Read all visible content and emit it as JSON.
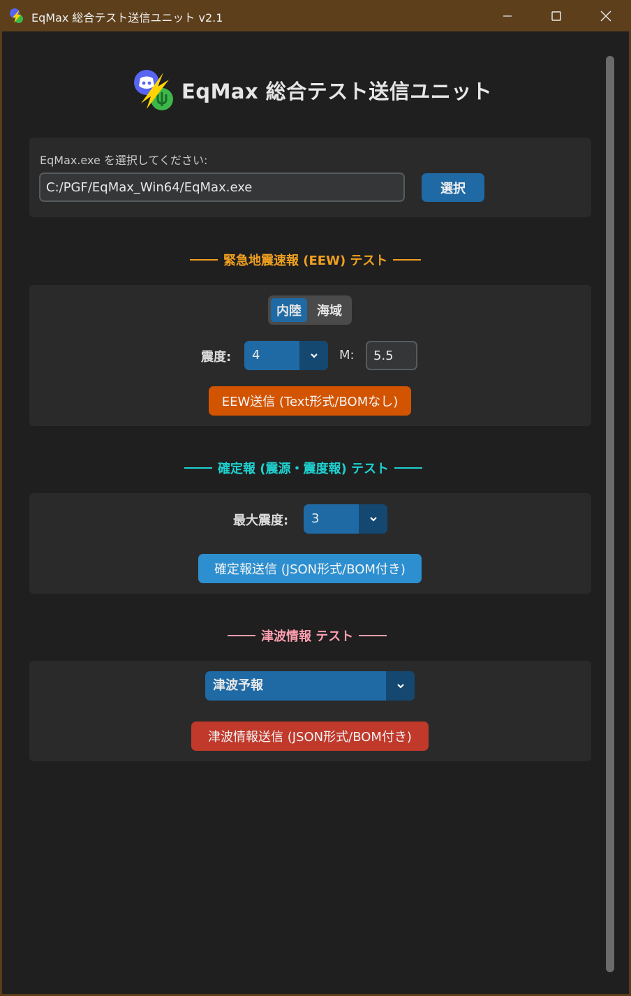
{
  "window": {
    "title": "EqMax 総合テスト送信ユニット v2.1"
  },
  "header": {
    "title": "EqMax 総合テスト送信ユニット"
  },
  "file_section": {
    "label": "EqMax.exe を選択してください:",
    "path_value": "C:/PGF/EqMax_Win64/EqMax.exe",
    "select_button": "選択"
  },
  "eew_section": {
    "title": "緊急地震速報 (EEW) テスト",
    "title_color": "#f0a020",
    "segments": [
      "内陸",
      "海域"
    ],
    "selected_segment": "内陸",
    "intensity_label": "震度:",
    "intensity_value": "4",
    "magnitude_label": "M:",
    "magnitude_value": "5.5",
    "send_button": "EEW送信 (Text形式/BOMなし)",
    "send_color": "#d35400"
  },
  "confirm_section": {
    "title": "確定報 (震源・震度報) テスト",
    "title_color": "#1fd1d1",
    "max_intensity_label": "最大震度:",
    "max_intensity_value": "3",
    "send_button": "確定報送信 (JSON形式/BOM付き)",
    "send_color": "#2d8fd0"
  },
  "tsunami_section": {
    "title": "津波情報 テスト",
    "title_color": "#ff9fb0",
    "type_value": "津波予報",
    "send_button": "津波情報送信 (JSON形式/BOM付き)",
    "send_color": "#c0392b"
  },
  "icons": {
    "app": "discord-lightning-icon",
    "minimize": "minimize-icon",
    "maximize": "maximize-icon",
    "close": "close-icon",
    "dropdown": "chevron-down-icon"
  }
}
